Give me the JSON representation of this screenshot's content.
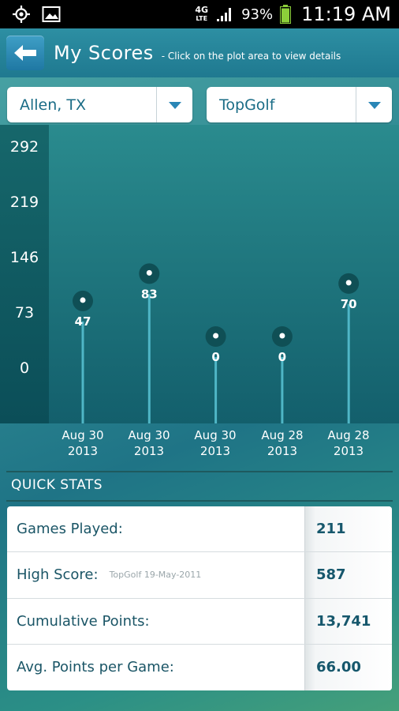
{
  "status_bar": {
    "network": "4G",
    "network_sub": "LTE",
    "battery": "93%",
    "time": "11:19 AM",
    "icons": [
      "gps-icon",
      "gallery-icon",
      "signal-icon",
      "battery-icon"
    ]
  },
  "header": {
    "title": "My Scores",
    "subtitle": "- Click on the plot area to view details"
  },
  "filters": {
    "location": "Allen, TX",
    "venue": "TopGolf"
  },
  "chart_data": {
    "type": "scatter",
    "y_ticks": [
      292,
      219,
      146,
      73,
      0
    ],
    "ylim": [
      0,
      292
    ],
    "points": [
      {
        "date": "Aug 30",
        "year": "2013",
        "value": 47
      },
      {
        "date": "Aug 30",
        "year": "2013",
        "value": 83
      },
      {
        "date": "Aug 30",
        "year": "2013",
        "value": 0
      },
      {
        "date": "Aug 28",
        "year": "2013",
        "value": 0
      },
      {
        "date": "Aug 28",
        "year": "2013",
        "value": 70
      }
    ],
    "colors": {
      "panel": "#1b6e76",
      "axis_band": "#0f5a62",
      "stem": "#4fb6c6",
      "marker": "#0f4f55"
    }
  },
  "quick_stats": {
    "title": "QUICK STATS",
    "rows": [
      {
        "label": "Games Played:",
        "note": "",
        "value": "211"
      },
      {
        "label": "High Score:",
        "note": "TopGolf 19-May-2011",
        "value": "587"
      },
      {
        "label": "Cumulative Points:",
        "note": "",
        "value": "13,741"
      },
      {
        "label": "Avg. Points per Game:",
        "note": "",
        "value": "66.00"
      }
    ]
  }
}
